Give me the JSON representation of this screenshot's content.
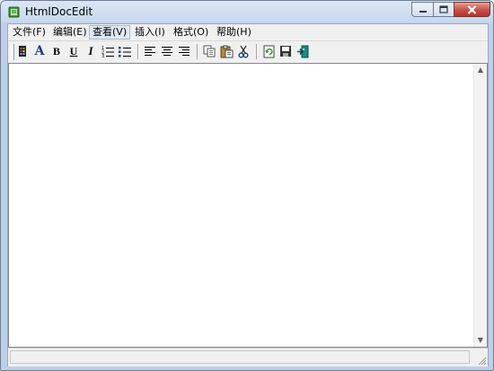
{
  "window": {
    "title": "HtmlDocEdit",
    "icon": "notebook-icon",
    "controls": [
      "minimize-icon",
      "maximize-icon",
      "close-icon"
    ]
  },
  "menu": {
    "items": [
      {
        "label": "文件(F)",
        "active": false
      },
      {
        "label": "编辑(E)",
        "active": false
      },
      {
        "label": "查看(V)",
        "active": true
      },
      {
        "label": "插入(I)",
        "active": false
      },
      {
        "label": "格式(O)",
        "active": false
      },
      {
        "label": "帮助(H)",
        "active": false
      }
    ]
  },
  "toolbar": {
    "font_label": "A",
    "bold_label": "B",
    "underline_label": "U",
    "italic_label": "I",
    "buttons": [
      "color-icon",
      "font-icon",
      "bold-icon",
      "underline-icon",
      "italic-icon",
      "numbered-list-icon",
      "bullet-list-icon",
      "align-left-icon",
      "align-center-icon",
      "align-right-icon",
      "copy-icon",
      "paste-icon",
      "cut-icon",
      "refresh-icon",
      "save-icon",
      "exit-icon"
    ]
  },
  "editor": {
    "content": ""
  },
  "status": {
    "text": ""
  },
  "colors": {
    "accent": "#2a5aa8",
    "close_button": "#c75049",
    "window_frame": "#bed0e8"
  }
}
